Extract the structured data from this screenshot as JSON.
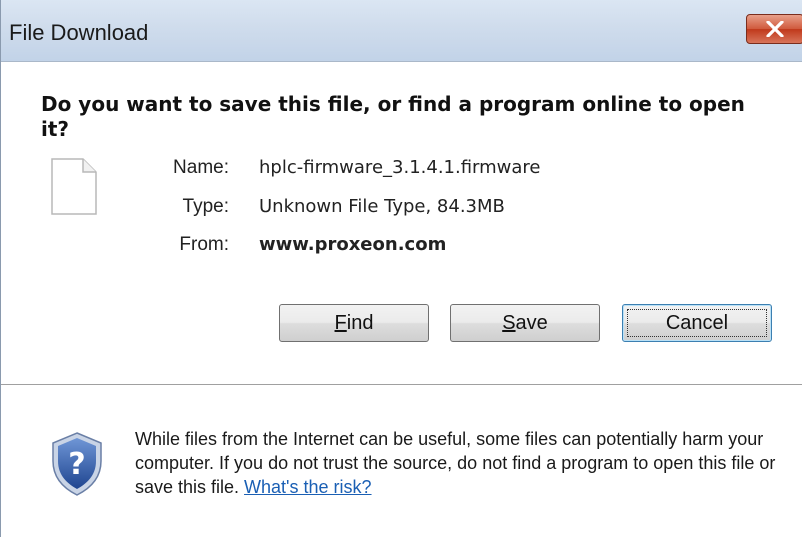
{
  "window": {
    "title": "File Download"
  },
  "dialog": {
    "question": "Do you want to save this file, or find a program online to open it?",
    "file": {
      "name_label": "Name:",
      "name_value": "hplc-firmware_3.1.4.1.firmware",
      "type_label": "Type:",
      "type_value": "Unknown File Type, 84.3MB",
      "from_label": "From:",
      "from_value": "www.proxeon.com"
    },
    "buttons": {
      "find": {
        "accel": "F",
        "rest": "ind"
      },
      "save": {
        "accel": "S",
        "rest": "ave"
      },
      "cancel": "Cancel"
    }
  },
  "footer": {
    "warning_text": "While files from the Internet can be useful, some files can potentially harm your computer. If you do not trust the source, do not find a program to open this file or save this file. ",
    "risk_link": "What's the risk?"
  },
  "icons": {
    "close": "close-icon",
    "file": "file-icon",
    "help": "help-shield-icon"
  },
  "colors": {
    "close_button": "#c0391b",
    "link": "#1a5fb4",
    "shield": "#2c57a3"
  }
}
